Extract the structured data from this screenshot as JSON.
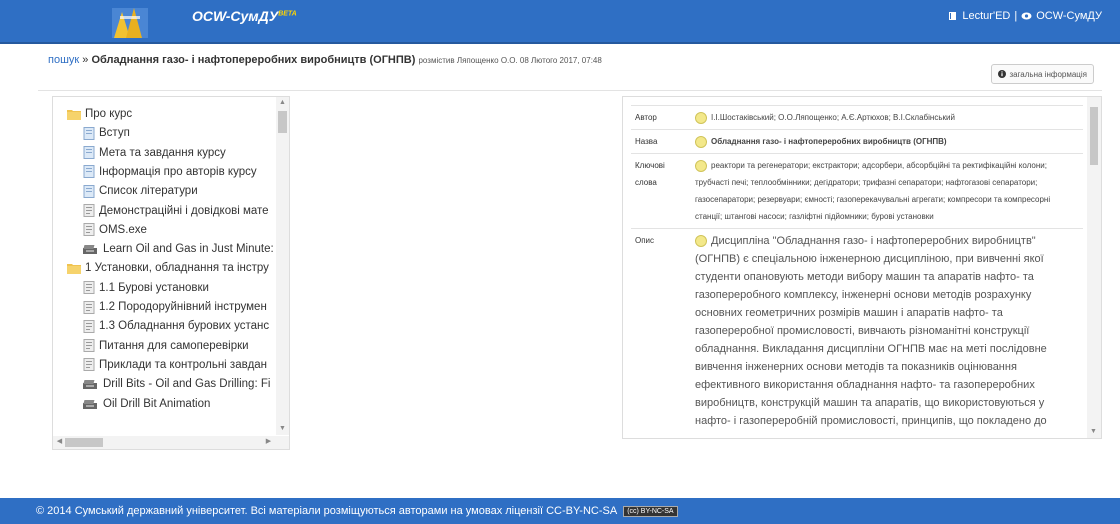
{
  "header": {
    "brand": "ОСW-СумДУ",
    "brand_sup": "BETA",
    "user": "Lectur'ED",
    "separator": "|",
    "site_link": "ОСW-СумДУ"
  },
  "breadcrumb": {
    "search_link": "пошук",
    "arrow": "»",
    "title": "Обладнання газо- і нафтопереробних виробництв (ОГНПВ)",
    "sub": "розмістив Ляпощенко О.О. 08 Лютого 2017, 07:48"
  },
  "info_button": {
    "label": "загальна інформація"
  },
  "tree": {
    "items": [
      {
        "label": "Про курс"
      },
      {
        "label": "Вступ"
      },
      {
        "label": "Мета та завдання курсу"
      },
      {
        "label": "Інформація про авторів курсу"
      },
      {
        "label": "Список літератури"
      },
      {
        "label": "Демонстраційні і довідкові мате"
      },
      {
        "label": "OMS.exe"
      },
      {
        "label": "Learn Oil and Gas in Just Minute:"
      },
      {
        "label": "1 Установки, обладнання та інстру"
      },
      {
        "label": "1.1 Бурові установки"
      },
      {
        "label": "1.2 Породоруйнівний інструмен"
      },
      {
        "label": "1.3 Обладнання бурових устанс"
      },
      {
        "label": "Питання для самоперевірки"
      },
      {
        "label": "Приклади та контрольні завдан"
      },
      {
        "label": "Drill Bits - Oil and Gas Drilling: Fi"
      },
      {
        "label": "Oil Drill Bit Animation"
      }
    ]
  },
  "meta": {
    "rows": [
      {
        "label": "Автор",
        "value": "І.І.Шостаківський; О.О.Ляпощенко; А.Є.Артюхов; В.І.Склабінський"
      },
      {
        "label": "Назва",
        "value": "Обладнання газо- і нафтопереробних виробництв (ОГНПВ)"
      },
      {
        "label": "Ключові слова",
        "value": "реактори та регенератори; екстрактори; адсорбери, абсорбційні та ректифікаційні колони; трубчасті печі; теплообмінники; дегідратори; трифазні сепаратори; нафтогазові сепаратори; газосепаратори; резервуари; ємності; газоперекачувальні агрегати; компресори та компресорні станції; штангові насоси; газліфтні підйомники; бурові установки"
      },
      {
        "label": "Опис",
        "value": "Дисципліна \"Обладнання газо- і нафтопереробних виробництв\" (ОГНПВ) є спеціальною інженерною дисципліною, при вивченні якої студенти опановують методи вибору машин та апаратів нафто- та газопереробного комплексу, інженерні основи методів розрахунку основних геометричних розмірів машин і апаратів нафто- та газопереробної промисловості, вивчають різноманітні конструкції обладнання. Викладання дисципліни ОГНПВ має на меті послідовне вивчення інженерних основи методів та показників оцінювання ефективного використання обладнання нафто- та газопереробних виробництв, конструкцій машин та апаратів, що використовуються у нафто- і газопереробній промисловості, принципів, що покладено до"
      }
    ]
  },
  "footer": {
    "text": "© 2014 Сумський державний університет. Всі матеріали розміщуються авторами на умовах ліцензії CC-BY-NC-SA",
    "badge": "(cc) BY-NC-SA"
  },
  "colors": {
    "accent": "#2f6fc4",
    "link": "#2f6fc4"
  }
}
